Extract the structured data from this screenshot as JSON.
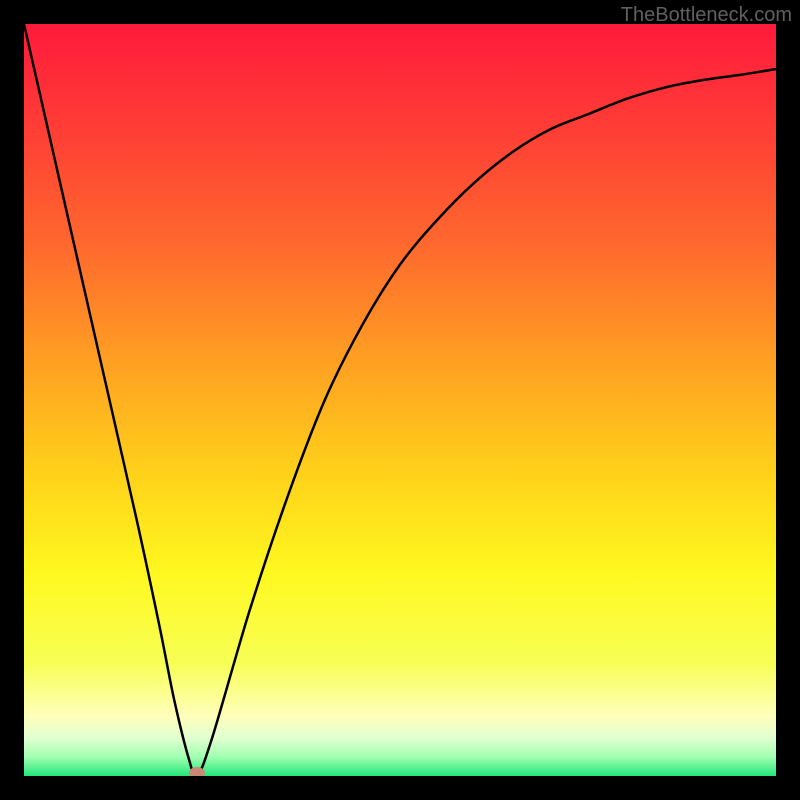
{
  "watermark": "TheBottleneck.com",
  "chart_data": {
    "type": "line",
    "title": "",
    "xlabel": "",
    "ylabel": "",
    "xlim": [
      0,
      100
    ],
    "ylim": [
      0,
      100
    ],
    "x": [
      0,
      5,
      10,
      15,
      18,
      20,
      22,
      23,
      25,
      30,
      35,
      40,
      45,
      50,
      55,
      60,
      65,
      70,
      75,
      80,
      85,
      90,
      95,
      100
    ],
    "values": [
      100,
      78,
      56,
      34,
      20,
      10,
      2,
      0,
      5,
      22,
      37,
      50,
      60,
      68,
      74,
      79,
      83,
      86,
      88,
      90,
      91.5,
      92.5,
      93.2,
      94
    ],
    "marker": {
      "x": 23,
      "y": 0
    },
    "gradient_stops": [
      {
        "offset": 0.0,
        "color": "#ff1a3b"
      },
      {
        "offset": 0.15,
        "color": "#ff4035"
      },
      {
        "offset": 0.3,
        "color": "#ff6a2d"
      },
      {
        "offset": 0.45,
        "color": "#ffa022"
      },
      {
        "offset": 0.6,
        "color": "#ffd21a"
      },
      {
        "offset": 0.73,
        "color": "#fff81f"
      },
      {
        "offset": 0.85,
        "color": "#f7ff55"
      },
      {
        "offset": 0.92,
        "color": "#ffffbb"
      },
      {
        "offset": 0.95,
        "color": "#e0ffd0"
      },
      {
        "offset": 0.975,
        "color": "#a0ffb0"
      },
      {
        "offset": 1.0,
        "color": "#22e67a"
      }
    ]
  }
}
